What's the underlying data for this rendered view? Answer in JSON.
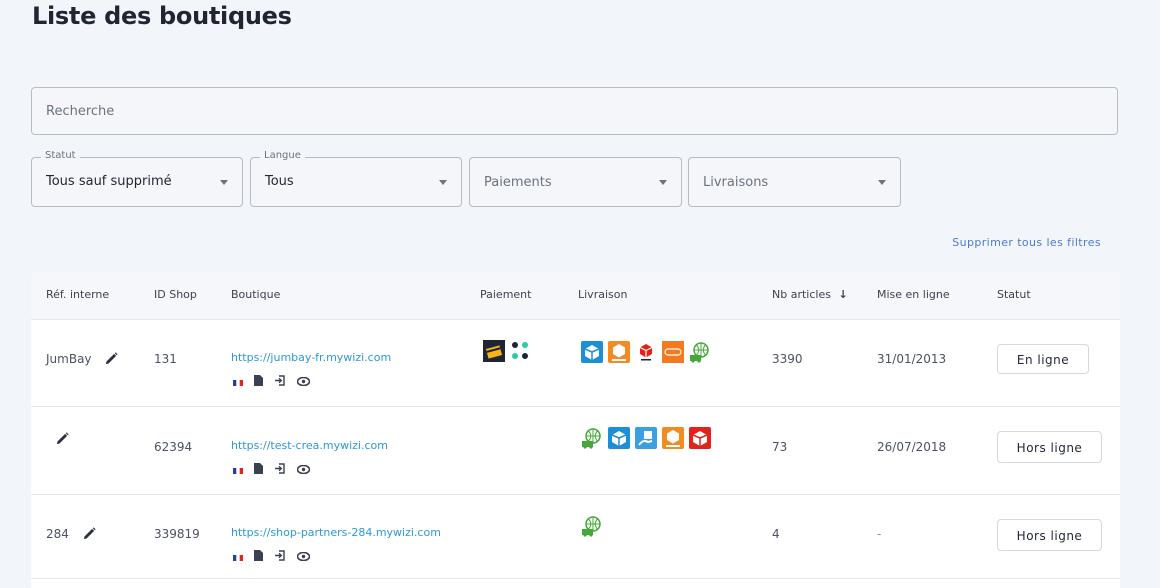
{
  "page": {
    "title": "Liste des boutiques"
  },
  "search": {
    "placeholder": "Recherche"
  },
  "filters": {
    "statut": {
      "label": "Statut",
      "value": "Tous sauf supprimé"
    },
    "langue": {
      "label": "Langue",
      "value": "Tous"
    },
    "paiements": {
      "placeholder": "Paiements"
    },
    "livraisons": {
      "placeholder": "Livraisons"
    },
    "clear_all": "Supprimer tous les filtres"
  },
  "table": {
    "headers": {
      "ref": "Réf. interne",
      "id_shop": "ID Shop",
      "boutique": "Boutique",
      "paiement": "Paiement",
      "livraison": "Livraison",
      "nb_articles": "Nb articles",
      "mise_en_ligne": "Mise en ligne",
      "statut": "Statut"
    },
    "sort_indicator": "↓",
    "rows": [
      {
        "ref": "JumBay",
        "id_shop": "131",
        "url": "https://jumbay-fr.mywizi.com",
        "payment_icons": [
          "card-payment-icon",
          "dots-payment-icon"
        ],
        "delivery_icons": [
          "package-blue-icon",
          "package-orange-icon",
          "package-red-icon",
          "tnt-icon",
          "globe-truck-icon"
        ],
        "nb_articles": "3390",
        "date": "31/01/2013",
        "status": "En ligne"
      },
      {
        "ref": "",
        "id_shop": "62394",
        "url": "https://test-crea.mywizi.com",
        "payment_icons": [],
        "delivery_icons": [
          "globe-truck-icon",
          "package-blue-icon",
          "package-hand-icon",
          "package-orange-icon",
          "package-red-icon"
        ],
        "nb_articles": "73",
        "date": "26/07/2018",
        "status": "Hors ligne"
      },
      {
        "ref": "284",
        "id_shop": "339819",
        "url": "https://shop-partners-284.mywizi.com",
        "payment_icons": [],
        "delivery_icons": [
          "globe-truck-icon"
        ],
        "nb_articles": "4",
        "date": "-",
        "status": "Hors ligne"
      }
    ]
  },
  "colors": {
    "accent": "#2b98d8",
    "link_blue": "#4a7bd0",
    "globe_green": "#45a83a",
    "package_blue": "#1e8fd6",
    "package_orange": "#f28b22",
    "package_red": "#e2231a",
    "tnt_orange": "#f47a20"
  }
}
